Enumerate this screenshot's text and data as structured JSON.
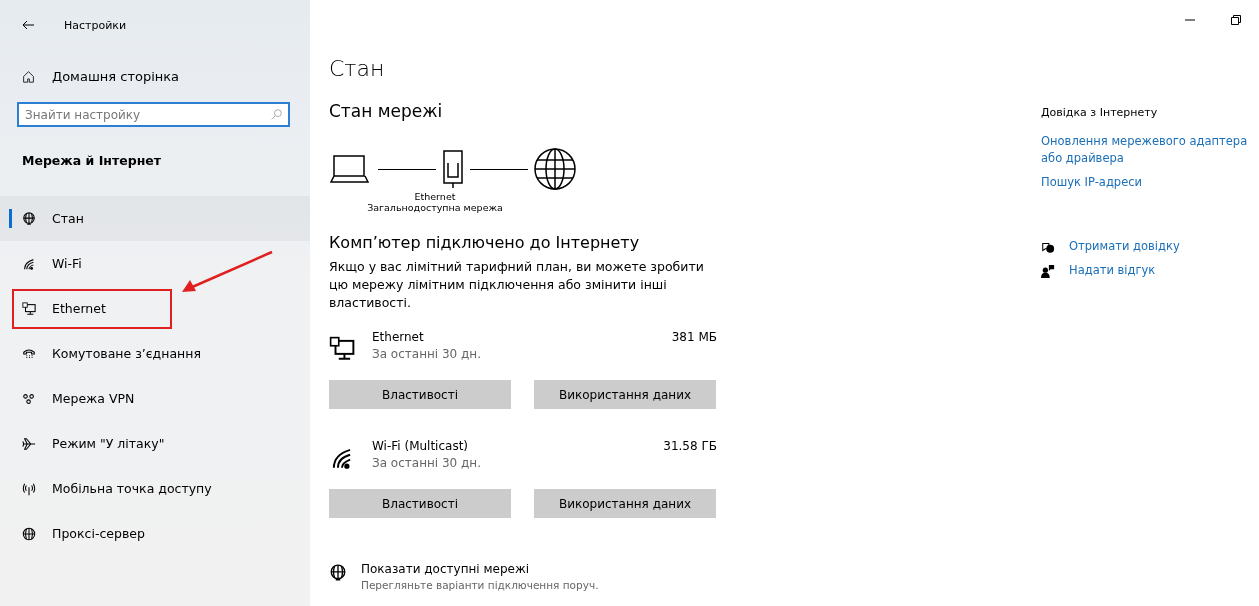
{
  "window": {
    "title": "Настройки"
  },
  "sidebar": {
    "home": "Домашня сторінка",
    "search": {
      "placeholder": "Знайти настройку"
    },
    "section": "Мережа й Інтернет",
    "items": [
      {
        "label": "Стан",
        "kind": "status",
        "selected": true,
        "annotated": false
      },
      {
        "label": "Wi-Fi",
        "kind": "wifi",
        "selected": false,
        "annotated": false
      },
      {
        "label": "Ethernet",
        "kind": "ethernet",
        "selected": false,
        "annotated": true
      },
      {
        "label": "Комутоване з’єднання",
        "kind": "dialup",
        "selected": false,
        "annotated": false
      },
      {
        "label": "Мережа VPN",
        "kind": "vpn",
        "selected": false,
        "annotated": false
      },
      {
        "label": "Режим \"У літаку\"",
        "kind": "airplane",
        "selected": false,
        "annotated": false
      },
      {
        "label": "Мобільна точка доступу",
        "kind": "hotspot",
        "selected": false,
        "annotated": false
      },
      {
        "label": "Проксі-сервер",
        "kind": "proxy",
        "selected": false,
        "annotated": false
      }
    ]
  },
  "main": {
    "title": "Стан",
    "subtitle": "Стан мережі",
    "diagram": {
      "adapter": "Ethernet",
      "network": "Загальнодоступна мережа"
    },
    "connected_heading": "Комп’ютер підключено до Інтернету",
    "connected_text": "Якщо у вас лімітний тарифний план, ви можете зробити цю мережу лімітним підключення або змінити інші властивості.",
    "adapters": [
      {
        "kind": "ethernet",
        "name": "Ethernet",
        "period": "За останні 30 дн.",
        "usage": "381 МБ",
        "buttons": [
          "Властивості",
          "Використання даних"
        ]
      },
      {
        "kind": "wifi",
        "name": "Wi-Fi (Multicast)",
        "period": "За останні 30 дн.",
        "usage": "31.58 ГБ",
        "buttons": [
          "Властивості",
          "Використання даних"
        ]
      }
    ],
    "show_networks": {
      "title": "Показати доступні мережі",
      "subtitle": "Перегляньте варіанти підключення поруч."
    }
  },
  "help": {
    "heading": "Довідка з Інтернету",
    "links": [
      "Оновлення мережевого адаптера або драйвера",
      "Пошук IP-адреси"
    ],
    "actions": [
      {
        "kind": "help",
        "label": "Отримати довідку"
      },
      {
        "kind": "feedback",
        "label": "Надати відгук"
      }
    ]
  }
}
